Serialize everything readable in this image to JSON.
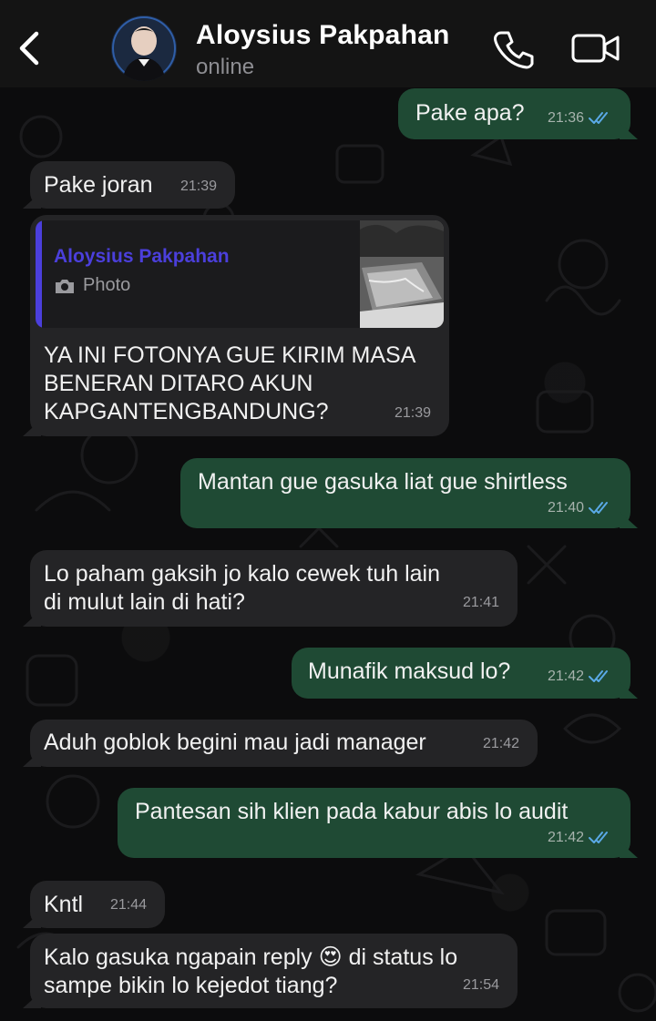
{
  "header": {
    "back_icon": "chevron-left-icon",
    "contact_name": "Aloysius Pakpahan",
    "status": "online",
    "call_icon": "phone-icon",
    "video_icon": "video-camera-icon"
  },
  "colors": {
    "outgoing": "#1f4a34",
    "incoming": "#242426",
    "quote_accent": "#4b3fdc",
    "read_ticks": "#5aa9e6"
  },
  "messages": [
    {
      "dir": "out",
      "text": "Pake apa?",
      "time": "21:36",
      "read": true
    },
    {
      "dir": "in",
      "text": "Pake joran",
      "time": "21:39"
    },
    {
      "dir": "in",
      "reply_to": {
        "author": "Aloysius Pakpahan",
        "kind": "Photo"
      },
      "text": "YA INI FOTONYA GUE KIRIM MASA BENERAN DITARO AKUN KAPGANTENGBANDUNG?",
      "time": "21:39"
    },
    {
      "dir": "out",
      "text": "Mantan gue gasuka liat gue shirtless",
      "time": "21:40",
      "read": true
    },
    {
      "dir": "in",
      "text": "Lo paham gaksih jo kalo cewek tuh lain di mulut lain di hati?",
      "time": "21:41"
    },
    {
      "dir": "out",
      "text": "Munafik maksud lo?",
      "time": "21:42",
      "read": true
    },
    {
      "dir": "in",
      "text": "Aduh goblok begini mau jadi manager",
      "time": "21:42"
    },
    {
      "dir": "out",
      "text": "Pantesan sih klien pada kabur abis lo audit",
      "time": "21:42",
      "read": true
    },
    {
      "dir": "in",
      "text": "Kntl",
      "time": "21:44"
    },
    {
      "dir": "in",
      "text": "Kalo gasuka ngapain reply 😍 di status lo sampe bikin lo kejedot tiang?",
      "time": "21:54"
    }
  ]
}
